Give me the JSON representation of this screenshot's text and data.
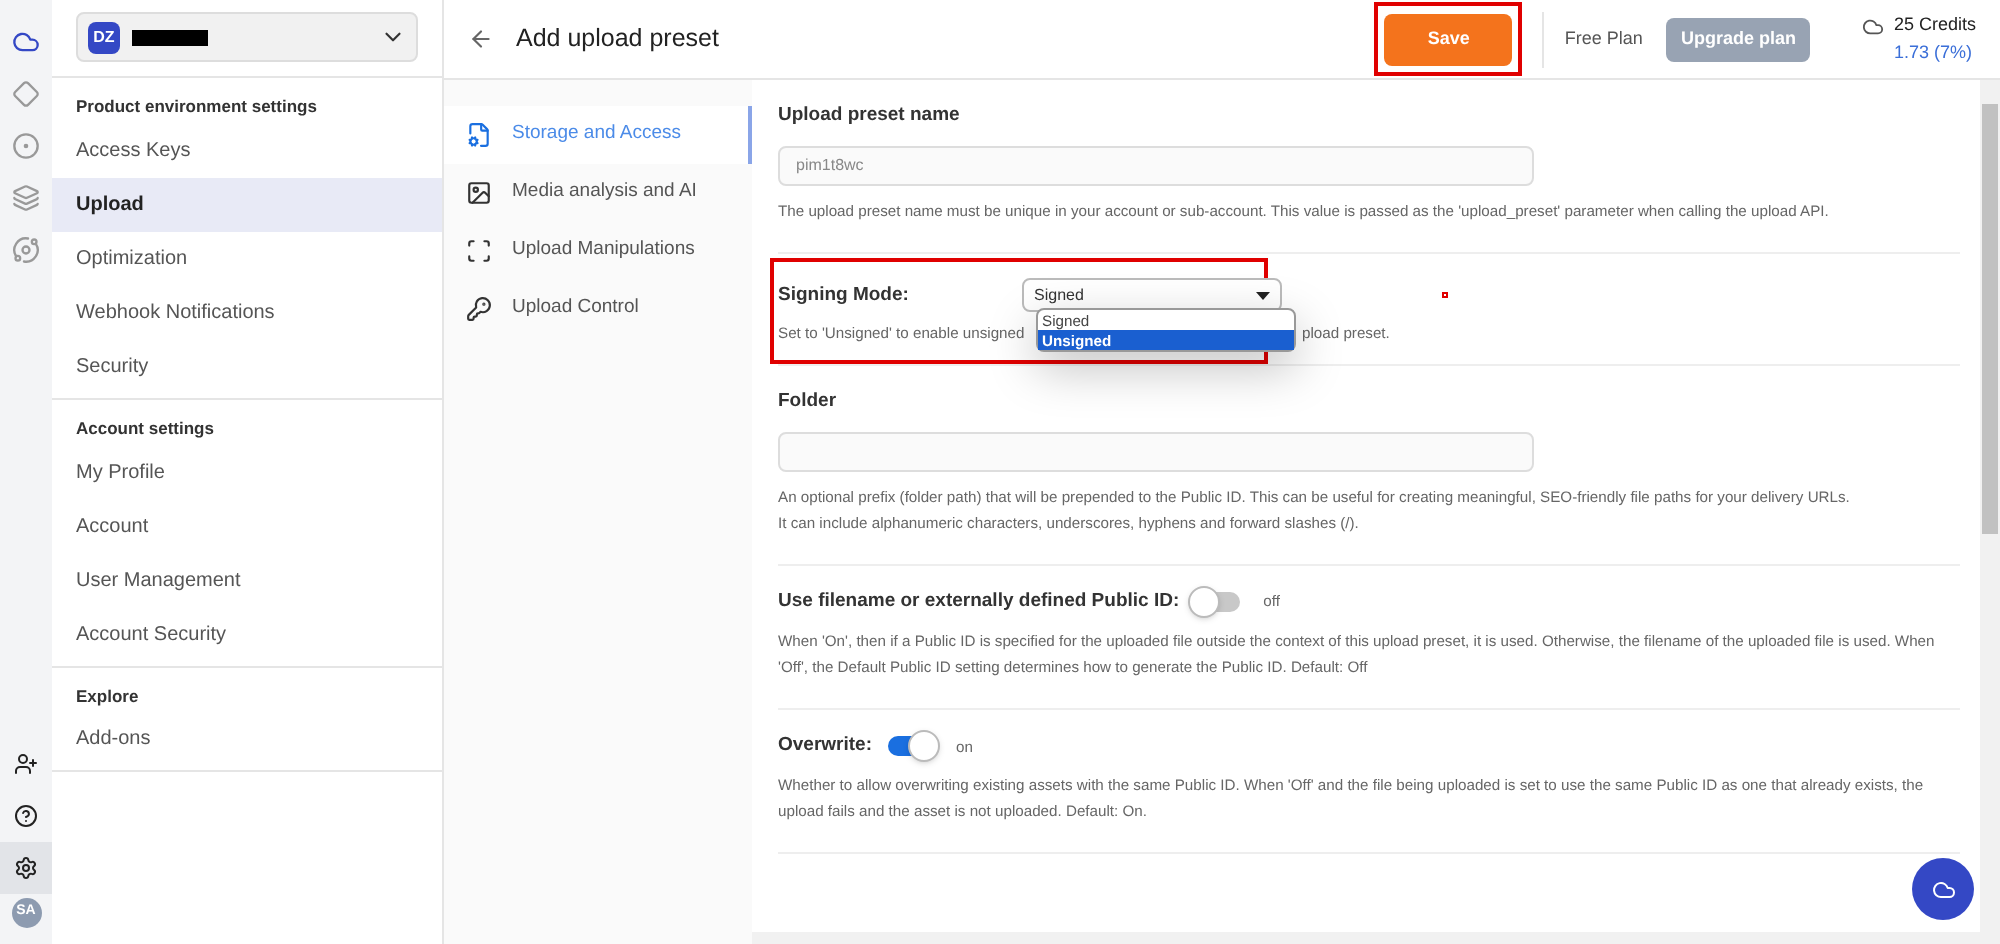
{
  "rail": {
    "top_icons": [
      {
        "kind": "cloud"
      },
      {
        "kind": "diamond"
      },
      {
        "kind": "rings"
      },
      {
        "kind": "stack"
      },
      {
        "kind": "planet"
      }
    ],
    "bottom_icons": [
      {
        "kind": "add-user",
        "selected": false
      },
      {
        "kind": "help",
        "selected": false
      },
      {
        "kind": "settings",
        "selected": true
      }
    ],
    "avatar": "SA"
  },
  "account": {
    "badge": "DZ"
  },
  "sidebar": {
    "sections": [
      {
        "title": "Product environment settings",
        "items": [
          {
            "label": "Access Keys",
            "selected": false
          },
          {
            "label": "Upload",
            "selected": true
          },
          {
            "label": "Optimization",
            "selected": false
          },
          {
            "label": "Webhook Notifications",
            "selected": false
          },
          {
            "label": "Security",
            "selected": false
          }
        ]
      },
      {
        "title": "Account settings",
        "items": [
          {
            "label": "My Profile",
            "selected": false
          },
          {
            "label": "Account",
            "selected": false
          },
          {
            "label": "User Management",
            "selected": false
          },
          {
            "label": "Account Security",
            "selected": false
          }
        ]
      },
      {
        "title": "Explore",
        "items": [
          {
            "label": "Add-ons",
            "selected": false
          }
        ]
      }
    ]
  },
  "header": {
    "title": "Add upload preset",
    "save": "Save",
    "plan": "Free Plan",
    "upgrade": "Upgrade plan",
    "credits": "25 Credits",
    "usage": "1.73 (7%)"
  },
  "sections_nav": [
    {
      "label": "Storage and Access",
      "kind": "file",
      "selected": true
    },
    {
      "label": "Media analysis and AI",
      "kind": "image",
      "selected": false
    },
    {
      "label": "Upload Manipulations",
      "kind": "frame",
      "selected": false
    },
    {
      "label": "Upload Control",
      "kind": "key",
      "selected": false
    }
  ],
  "form": [
    {
      "kind": "text",
      "label": "Upload preset name",
      "value": "pim1t8wc",
      "help": [
        "The upload preset name must be unique in your account or sub-account. This value is passed as the 'upload_preset' parameter when calling the upload API."
      ]
    },
    {
      "kind": "select",
      "label": "Signing Mode:",
      "value": "Signed",
      "help_before": "Set to 'Unsigned' to enable unsigned",
      "help_after": "pload preset.",
      "options": [
        {
          "label": "Signed",
          "highlighted": false
        },
        {
          "label": "Unsigned",
          "highlighted": true
        }
      ],
      "highlighted": true
    },
    {
      "kind": "text",
      "label": "Folder",
      "help": [
        "An optional prefix (folder path) that will be prepended to the Public ID. This can be useful for creating meaningful, SEO-friendly file paths for your delivery URLs.",
        "It can include alphanumeric characters, underscores, hyphens and forward slashes (/)."
      ]
    },
    {
      "kind": "toggle",
      "label": "Use filename or externally defined Public ID:",
      "on": false,
      "state": "off",
      "help": [
        "When 'On', then if a Public ID is specified for the uploaded file outside the context of this upload preset, it is used. Otherwise, the filename of the uploaded file is used. When 'Off', the Default Public ID setting determines how to generate the Public ID. Default: Off"
      ]
    },
    {
      "kind": "toggle",
      "label": "Overwrite:",
      "on": true,
      "state": "on",
      "help": [
        "Whether to allow overwriting existing assets with the same Public ID. When 'Off' and the file being uploaded is set to use the same Public ID as one that already exists, the upload fails and the asset is not uploaded. Default: On."
      ]
    }
  ]
}
